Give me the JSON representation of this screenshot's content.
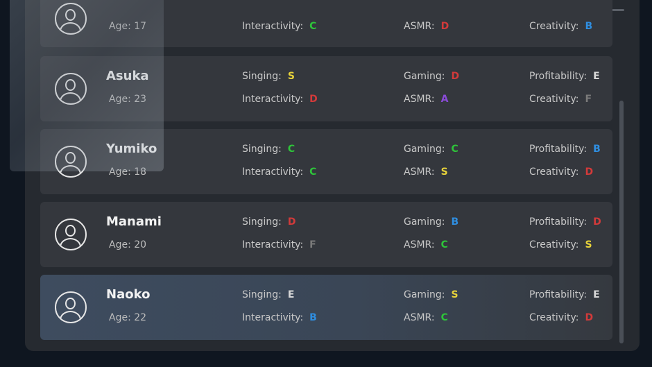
{
  "grade_colors": {
    "S": "#e8d33a",
    "A": "#8a4bd8",
    "B": "#2f8ee0",
    "C": "#2ec43a",
    "D": "#d23a3a",
    "E": "#d8d8d8",
    "F": "#7a7a7a"
  },
  "characters": [
    {
      "name": "",
      "age_text": "Age: 17",
      "stats": {
        "interactivity": {
          "label": "Interactivity:",
          "grade": "C"
        },
        "asmr": {
          "label": "ASMR:",
          "grade": "D"
        },
        "creativity": {
          "label": "Creativity:",
          "grade": "B"
        }
      }
    },
    {
      "name": "Asuka",
      "age_text": "Age: 23",
      "stats": {
        "singing": {
          "label": "Singing:",
          "grade": "S"
        },
        "gaming": {
          "label": "Gaming:",
          "grade": "D"
        },
        "profitability": {
          "label": "Profitability:",
          "grade": "E"
        },
        "interactivity": {
          "label": "Interactivity:",
          "grade": "D"
        },
        "asmr": {
          "label": "ASMR:",
          "grade": "A"
        },
        "creativity": {
          "label": "Creativity:",
          "grade": "F"
        }
      }
    },
    {
      "name": "Yumiko",
      "age_text": "Age: 18",
      "stats": {
        "singing": {
          "label": "Singing:",
          "grade": "C"
        },
        "gaming": {
          "label": "Gaming:",
          "grade": "C"
        },
        "profitability": {
          "label": "Profitability:",
          "grade": "B"
        },
        "interactivity": {
          "label": "Interactivity:",
          "grade": "C"
        },
        "asmr": {
          "label": "ASMR:",
          "grade": "S"
        },
        "creativity": {
          "label": "Creativity:",
          "grade": "D"
        }
      }
    },
    {
      "name": "Manami",
      "age_text": "Age: 20",
      "stats": {
        "singing": {
          "label": "Singing:",
          "grade": "D"
        },
        "gaming": {
          "label": "Gaming:",
          "grade": "B"
        },
        "profitability": {
          "label": "Profitability:",
          "grade": "D"
        },
        "interactivity": {
          "label": "Interactivity:",
          "grade": "F"
        },
        "asmr": {
          "label": "ASMR:",
          "grade": "C"
        },
        "creativity": {
          "label": "Creativity:",
          "grade": "S"
        }
      }
    },
    {
      "name": "Naoko",
      "age_text": "Age: 22",
      "selected": true,
      "stats": {
        "singing": {
          "label": "Singing:",
          "grade": "E"
        },
        "gaming": {
          "label": "Gaming:",
          "grade": "S"
        },
        "profitability": {
          "label": "Profitability:",
          "grade": "E"
        },
        "interactivity": {
          "label": "Interactivity:",
          "grade": "B"
        },
        "asmr": {
          "label": "ASMR:",
          "grade": "C"
        },
        "creativity": {
          "label": "Creativity:",
          "grade": "D"
        }
      }
    }
  ]
}
